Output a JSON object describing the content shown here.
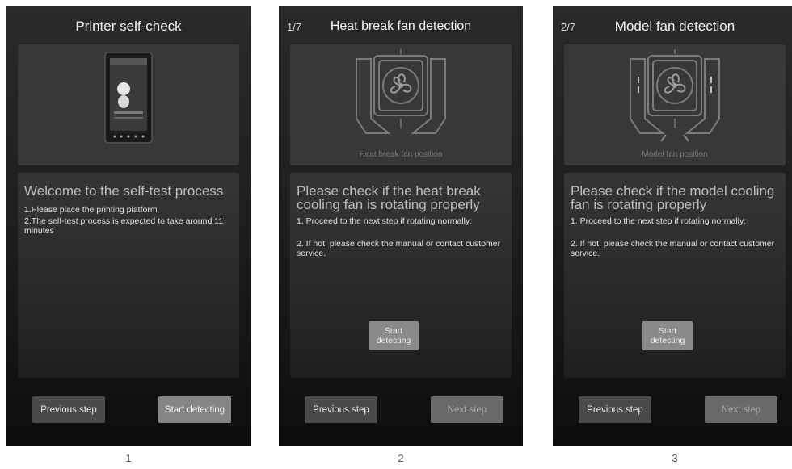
{
  "screens": [
    {
      "title": "Printer self-check",
      "heading": "Welcome to the self-test process",
      "lines": [
        "1.Please place the printing platform",
        "2.The self-test process is expected to take around 11 minutes"
      ],
      "prev_label": "Previous step",
      "next_label": "Start detecting",
      "caption": "1"
    },
    {
      "step": "1/7",
      "title": "Heat break fan detection",
      "image_caption": "Heat break fan position",
      "heading": "Please check if the heat break cooling fan is rotating properly",
      "lines": [
        "1. Proceed to the next step if rotating normally;",
        "2. If not, please check the manual or contact customer service."
      ],
      "detect_label": "Start detecting",
      "prev_label": "Previous step",
      "next_label": "Next step",
      "caption": "2"
    },
    {
      "step": "2/7",
      "title": "Model fan detection",
      "image_caption": "Model fan position",
      "heading": "Please check if the model cooling fan is rotating properly",
      "lines": [
        "1. Proceed to the next step if rotating normally;",
        "2. If not, please check the manual or contact customer service."
      ],
      "detect_label": "Start detecting",
      "prev_label": "Previous step",
      "next_label": "Next step",
      "caption": "3"
    }
  ]
}
